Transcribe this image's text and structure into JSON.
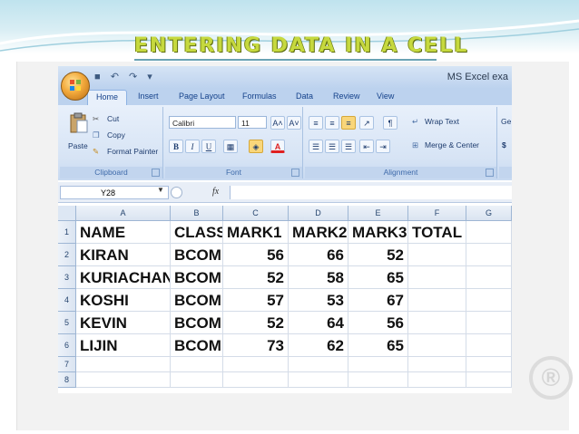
{
  "slide": {
    "title": "ENTERING DATA IN A CELL",
    "watermark": "®"
  },
  "excel": {
    "window_title": "MS Excel exa",
    "quick_access": "■ ↶ ↷ ▾",
    "tabs": [
      "Home",
      "Insert",
      "Page Layout",
      "Formulas",
      "Data",
      "Review",
      "View"
    ],
    "active_tab": "Home",
    "ribbon": {
      "clipboard": {
        "paste": "Paste",
        "cut": "Cut",
        "copy": "Copy",
        "format_painter": "Format Painter",
        "label": "Clipboard"
      },
      "font": {
        "font_name": "Calibri",
        "font_size": "11",
        "bold": "B",
        "italic": "I",
        "underline": "U",
        "grow": "A˄",
        "shrink": "A˅",
        "label": "Font"
      },
      "alignment": {
        "wrap_text": "Wrap Text",
        "merge_center": "Merge & Center",
        "label": "Alignment"
      },
      "number": {
        "general": "Ge",
        "currency": "$"
      }
    },
    "formula_bar": {
      "name_box": "Y28",
      "fx": "fx",
      "value": ""
    },
    "columns": [
      "A",
      "B",
      "C",
      "D",
      "E",
      "F",
      "G"
    ],
    "rows": [
      {
        "n": "1",
        "cells": [
          "NAME",
          "CLASS",
          "MARK1",
          "MARK2",
          "MARK3",
          "TOTAL",
          ""
        ]
      },
      {
        "n": "2",
        "cells": [
          "KIRAN",
          "BCOM",
          "56",
          "66",
          "52",
          "",
          ""
        ]
      },
      {
        "n": "3",
        "cells": [
          "KURIACHAN",
          "BCOM",
          "52",
          "58",
          "65",
          "",
          ""
        ]
      },
      {
        "n": "4",
        "cells": [
          "KOSHI",
          "BCOM",
          "57",
          "53",
          "67",
          "",
          ""
        ]
      },
      {
        "n": "5",
        "cells": [
          "KEVIN",
          "BCOM",
          "52",
          "64",
          "56",
          "",
          ""
        ]
      },
      {
        "n": "6",
        "cells": [
          "LIJIN",
          "BCOM",
          "73",
          "62",
          "65",
          "",
          ""
        ]
      },
      {
        "n": "7",
        "cells": [
          "",
          "",
          "",
          "",
          "",
          "",
          ""
        ]
      },
      {
        "n": "8",
        "cells": [
          "",
          "",
          "",
          "",
          "",
          "",
          ""
        ]
      }
    ]
  }
}
